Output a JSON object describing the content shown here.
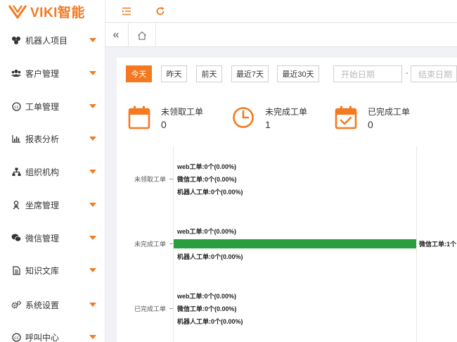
{
  "brand": {
    "name": "VIKI智能",
    "color": "#f47920"
  },
  "sidebar": {
    "items": [
      {
        "label": "机器人项目",
        "icon": "robot-icon"
      },
      {
        "label": "客户管理",
        "icon": "users-icon"
      },
      {
        "label": "工单管理",
        "icon": "ticket-icon"
      },
      {
        "label": "报表分析",
        "icon": "bar-chart-icon"
      },
      {
        "label": "组织机构",
        "icon": "sitemap-icon"
      },
      {
        "label": "坐席管理",
        "icon": "agent-icon"
      },
      {
        "label": "微信管理",
        "icon": "wechat-icon"
      },
      {
        "label": "知识文库",
        "icon": "document-icon"
      },
      {
        "label": "系统设置",
        "icon": "gears-icon"
      },
      {
        "label": "呼叫中心",
        "icon": "call-center-icon"
      }
    ]
  },
  "topbar": {
    "icons": [
      "menu-toggle-icon",
      "refresh-icon"
    ]
  },
  "tabs": {
    "collapse_glyph": "«",
    "home_icon": "home-icon"
  },
  "filters": {
    "buttons": [
      "今天",
      "昨天",
      "前天",
      "最近7天",
      "最近30天"
    ],
    "active": "今天",
    "start_placeholder": "开始日期",
    "separator": "-",
    "end_placeholder": "结束日期"
  },
  "stats": [
    {
      "label": "未领取工单",
      "value": "0",
      "icon": "calendar-icon"
    },
    {
      "label": "未完成工单",
      "value": "1",
      "icon": "clock-icon"
    },
    {
      "label": "已完成工单",
      "value": "0",
      "icon": "calendar-check-icon"
    }
  ],
  "chart_data": {
    "type": "bar",
    "orientation": "horizontal",
    "categories": [
      "未领取工单",
      "未完成工单",
      "已完成工单"
    ],
    "series": [
      {
        "name": "web工单",
        "values": [
          0,
          0,
          0
        ]
      },
      {
        "name": "微信工单",
        "values": [
          0,
          1,
          0
        ]
      },
      {
        "name": "机器人工单",
        "values": [
          0,
          0,
          0
        ]
      }
    ],
    "series_color": "#2a9d3e",
    "data_labels": [
      [
        "web工单:0个(0.00%)",
        "微信工单:0个(0.00%)",
        "机器人工单:0个(0.00%)"
      ],
      [
        "web工单:0个(0.00%)",
        "微信工单:1个",
        "机器人工单:0个(0.00%)"
      ],
      [
        "web工单:0个(0.00%)",
        "微信工单:0个(0.00%)",
        "机器人工单:0个(0.00%)"
      ]
    ],
    "xlim": [
      0,
      1
    ]
  }
}
